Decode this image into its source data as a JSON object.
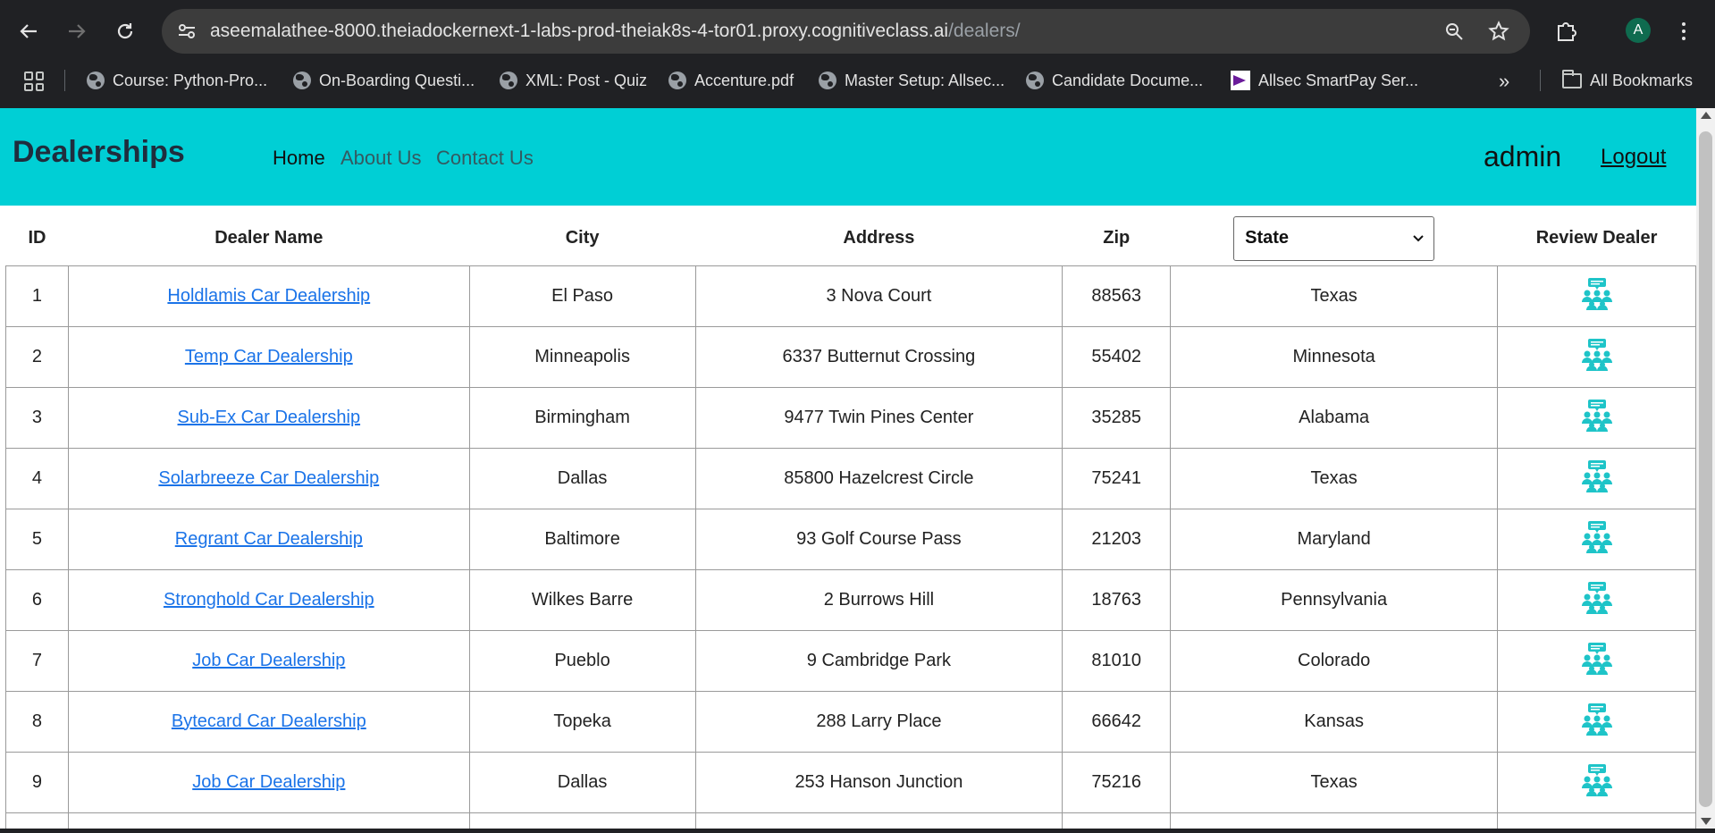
{
  "browser": {
    "url_host": "aseemalathee-8000.theiadockernext-1-labs-prod-theiak8s-4-tor01.proxy.cognitiveclass.ai",
    "url_path": "/dealers/",
    "profile_initial": "A",
    "bookmarks": [
      {
        "label": "Course: Python-Pro...",
        "icon": "globe-icon"
      },
      {
        "label": "On-Boarding Questi...",
        "icon": "globe-icon"
      },
      {
        "label": "XML: Post - Quiz",
        "icon": "globe-icon"
      },
      {
        "label": "Accenture.pdf",
        "icon": "globe-icon"
      },
      {
        "label": "Master Setup: Allsec...",
        "icon": "globe-icon"
      },
      {
        "label": "Candidate Docume...",
        "icon": "globe-icon"
      },
      {
        "label": "Allsec SmartPay Ser...",
        "icon": "smartpay-icon"
      }
    ],
    "more_bookmarks": "»",
    "all_bookmarks": "All Bookmarks"
  },
  "navbar": {
    "brand": "Dealerships",
    "links": [
      "Home",
      "About Us",
      "Contact Us"
    ],
    "user": "admin",
    "logout": "Logout",
    "color": "#00cfd5"
  },
  "table": {
    "headers": {
      "id": "ID",
      "name": "Dealer Name",
      "city": "City",
      "address": "Address",
      "zip": "Zip",
      "state_select": "State",
      "review": "Review Dealer"
    },
    "rows": [
      {
        "id": "1",
        "name": "Holdlamis Car Dealership",
        "city": "El Paso",
        "address": "3 Nova Court",
        "zip": "88563",
        "state": "Texas"
      },
      {
        "id": "2",
        "name": "Temp Car Dealership",
        "city": "Minneapolis",
        "address": "6337 Butternut Crossing",
        "zip": "55402",
        "state": "Minnesota"
      },
      {
        "id": "3",
        "name": "Sub-Ex Car Dealership",
        "city": "Birmingham",
        "address": "9477 Twin Pines Center",
        "zip": "35285",
        "state": "Alabama"
      },
      {
        "id": "4",
        "name": "Solarbreeze Car Dealership",
        "city": "Dallas",
        "address": "85800 Hazelcrest Circle",
        "zip": "75241",
        "state": "Texas"
      },
      {
        "id": "5",
        "name": "Regrant Car Dealership",
        "city": "Baltimore",
        "address": "93 Golf Course Pass",
        "zip": "21203",
        "state": "Maryland"
      },
      {
        "id": "6",
        "name": "Stronghold Car Dealership",
        "city": "Wilkes Barre",
        "address": "2 Burrows Hill",
        "zip": "18763",
        "state": "Pennsylvania"
      },
      {
        "id": "7",
        "name": "Job Car Dealership",
        "city": "Pueblo",
        "address": "9 Cambridge Park",
        "zip": "81010",
        "state": "Colorado"
      },
      {
        "id": "8",
        "name": "Bytecard Car Dealership",
        "city": "Topeka",
        "address": "288 Larry Place",
        "zip": "66642",
        "state": "Kansas"
      },
      {
        "id": "9",
        "name": "Job Car Dealership",
        "city": "Dallas",
        "address": "253 Hanson Junction",
        "zip": "75216",
        "state": "Texas"
      },
      {
        "id": "",
        "name": "",
        "city": "",
        "address": "",
        "zip": "",
        "state": ""
      }
    ],
    "review_icon": "review-people-icon",
    "review_icon_color": "#1ec4c8"
  }
}
